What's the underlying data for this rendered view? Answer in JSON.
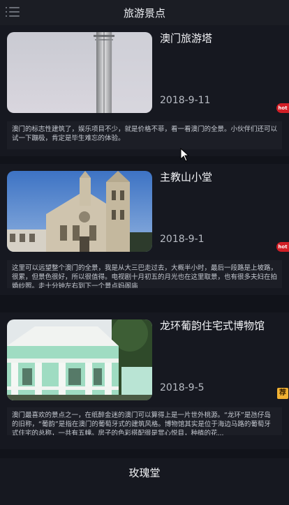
{
  "header": {
    "title": "旅游景点",
    "menu_icon": "menu-list-icon"
  },
  "attractions": [
    {
      "name": "澳门旅游塔",
      "date": "2018-9-11",
      "badge": "hot",
      "description": "澳门的标志性建筑了，娱乐项目不少，就是价格不菲，看一看澳门的全景。小伙伴们还可以试一下蹦极，肯定是毕生难忘的体验。"
    },
    {
      "name": "主教山小堂",
      "date": "2018-9-1",
      "badge": "hot",
      "description": "这里可以远望整个澳门的全景，我是从大三巴走过去，大概半小时，最后一段路是上坡路，很累，但景色很好，所以很值得。电视剧十月初五的月光也在这里取景，也有很多夫妇在拍婚纱照。走十分钟左右到下一个景点妈阁庙"
    },
    {
      "name": "龙环葡韵住宅式博物馆",
      "date": "2018-9-5",
      "badge": "荐",
      "description": "澳门最喜欢的景点之一，在纸醉金迷的澳门可以算得上是一片世外桃源。“龙环”是氹仔岛的旧称，“葡韵”是指在澳门的葡萄牙式的建筑风格。博物馆其实是位于海边马路的葡萄牙式住宅的总称，一共有五幢。房子的色彩搭配很是赏心悦目，种植的花..."
    },
    {
      "name": "玫瑰堂"
    }
  ],
  "colors": {
    "hot_badge": "#d21f26",
    "recommend_badge": "#f2b233",
    "background": "#11131a",
    "card": "#161820"
  }
}
